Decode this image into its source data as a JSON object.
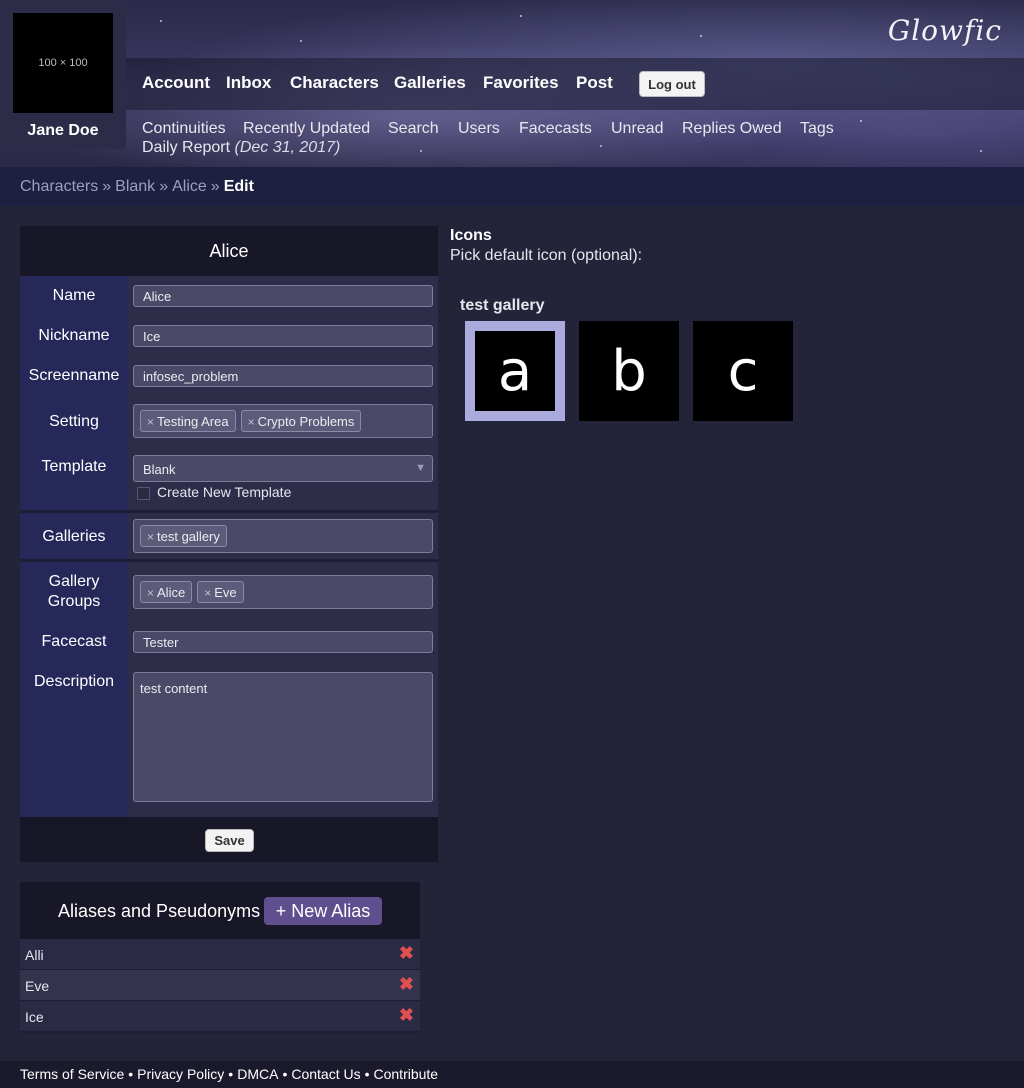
{
  "header": {
    "avatar_placeholder": "100 × 100",
    "username": "Jane Doe",
    "logo": "Glowfic",
    "nav": [
      "Account",
      "Inbox",
      "Characters",
      "Galleries",
      "Favorites",
      "Post"
    ],
    "logout_label": "Log out",
    "subnav": [
      "Continuities",
      "Recently Updated",
      "Search",
      "Users",
      "Facecasts",
      "Unread",
      "Replies Owed",
      "Tags"
    ],
    "daily_report": "Daily Report",
    "daily_report_date": "(Dec 31, 2017)"
  },
  "breadcrumb": {
    "items": [
      "Characters",
      "Blank",
      "Alice"
    ],
    "separator": "»",
    "current": "Edit"
  },
  "form": {
    "title": "Alice",
    "name_label": "Name",
    "name_value": "Alice",
    "nickname_label": "Nickname",
    "nickname_value": "Ice",
    "screenname_label": "Screenname",
    "screenname_value": "infosec_problem",
    "setting_label": "Setting",
    "setting_tags": [
      "Testing Area",
      "Crypto Problems"
    ],
    "template_label": "Template",
    "template_value": "Blank",
    "create_template_label": "Create New Template",
    "galleries_label": "Galleries",
    "gallery_tags": [
      "test gallery"
    ],
    "gallery_groups_label": "Gallery Groups",
    "gallery_group_tags": [
      "Alice",
      "Eve"
    ],
    "facecast_label": "Facecast",
    "facecast_value": "Tester",
    "description_label": "Description",
    "description_value": "test content",
    "save_label": "Save",
    "tag_remove_symbol": "×"
  },
  "aliases": {
    "title": "Aliases and Pseudonyms",
    "new_alias_label": "+ New Alias",
    "items": [
      "Alli",
      "Eve",
      "Ice"
    ],
    "delete_symbol": "✖"
  },
  "icons": {
    "title": "Icons",
    "subtitle": "Pick default icon (optional):",
    "gallery_name": "test gallery",
    "tiles": [
      "a",
      "b",
      "c"
    ],
    "selected_index": 0
  },
  "footer": {
    "links": [
      "Terms of Service",
      "Privacy Policy",
      "DMCA",
      "Contact Us",
      "Contribute"
    ],
    "separator": "•"
  },
  "colors": {
    "page_bg": "#23233a",
    "label_bg": "#27285a",
    "accent_button": "#5f4f8f",
    "delete_red": "#e05050",
    "selected_icon_border": "#aaaadd"
  }
}
